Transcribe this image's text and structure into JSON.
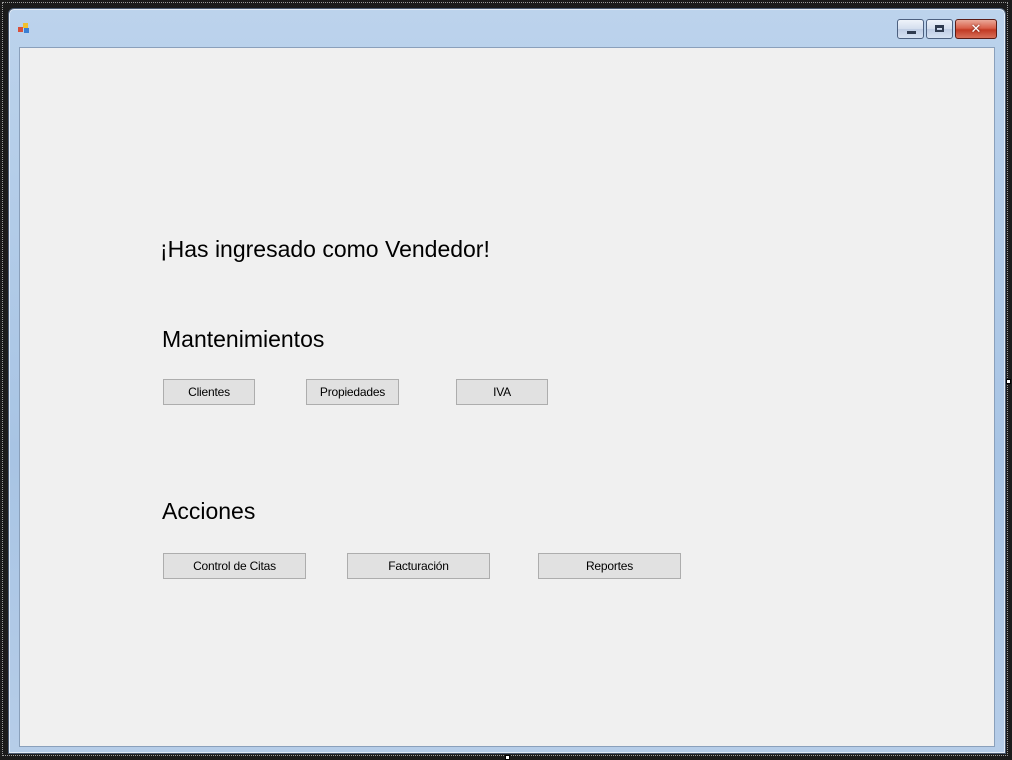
{
  "window": {
    "app_icon": "windows-form-icon",
    "buttons": {
      "minimize_icon": "minimize-icon",
      "maximize_icon": "maximize-icon",
      "close_icon": "close-icon",
      "close_glyph": "✕"
    }
  },
  "main": {
    "welcome": "¡Has ingresado como Vendedor!",
    "mantenimientos": {
      "title": "Mantenimientos",
      "buttons": [
        "Clientes",
        "Propiedades",
        "IVA"
      ]
    },
    "acciones": {
      "title": "Acciones",
      "buttons": [
        "Control de Citas",
        "Facturación",
        "Reportes"
      ]
    }
  },
  "colors": {
    "form_background": "#f0f0f0",
    "button_face": "#e1e1e1",
    "title_bar": "#bcd3ec",
    "close_button": "#c23a24"
  }
}
